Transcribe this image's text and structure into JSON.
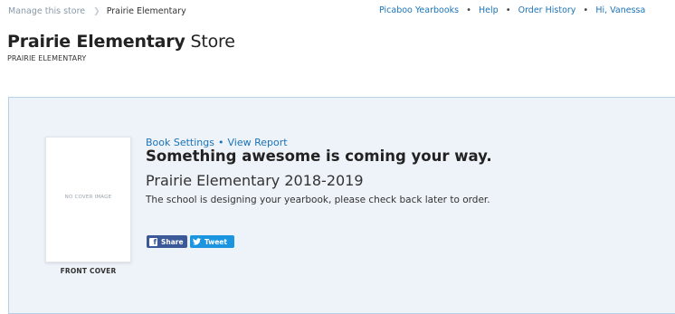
{
  "breadcrumb": {
    "manage_label": "Manage this store",
    "current_label": "Prairie Elementary"
  },
  "topnav": {
    "items": [
      "Picaboo Yearbooks",
      "Help",
      "Order History",
      "Hi, Vanessa"
    ],
    "separator": "•"
  },
  "store": {
    "title_bold": "Prairie Elementary",
    "title_rest": "Store",
    "subtitle": "PRAIRIE ELEMENTARY"
  },
  "book": {
    "cover_placeholder": "NO COVER IMAGE",
    "cover_label": "FRONT COVER",
    "links": {
      "settings": "Book Settings",
      "separator": "•",
      "report": "View Report"
    },
    "headline": "Something awesome is coming your way.",
    "name": "Prairie Elementary 2018-2019",
    "description": "The school is designing your yearbook, please check back later to order.",
    "share_label": "Share",
    "tweet_label": "Tweet"
  },
  "colors": {
    "link": "#1a73b8",
    "panel_bg": "#eef3f9",
    "panel_border": "#b8d1ea",
    "facebook": "#3b5998",
    "twitter": "#1b95e0"
  }
}
